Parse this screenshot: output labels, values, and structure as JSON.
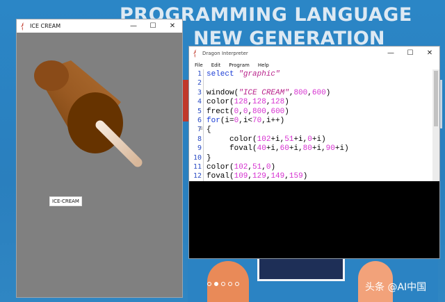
{
  "background": {
    "title_line1": "PROGRAMMING LANGUAGE",
    "title_line2": "NEW GENERATION",
    "watermark": "头条 @AI中国"
  },
  "ice_window": {
    "title": "ICE CREAM",
    "minimize": "—",
    "maximize": "☐",
    "close": "✕",
    "label": "ICE-CREAM",
    "canvas_color": "#808080"
  },
  "interpreter_window": {
    "title": "Dragon Interpreter",
    "minimize": "—",
    "maximize": "☐",
    "close": "✕",
    "menu": [
      "File",
      "Edit",
      "Program",
      "Help"
    ],
    "line_numbers": [
      "1",
      "2",
      "3",
      "4",
      "5",
      "6",
      "7",
      "8",
      "9",
      "10",
      "11",
      "12"
    ],
    "code": [
      [
        {
          "t": "kw",
          "v": "select "
        },
        {
          "t": "str",
          "v": "\"graphic\""
        }
      ],
      [],
      [
        {
          "t": "p",
          "v": "window("
        },
        {
          "t": "str",
          "v": "\"ICE CREAM\""
        },
        {
          "t": "p",
          "v": ","
        },
        {
          "t": "num",
          "v": "800"
        },
        {
          "t": "p",
          "v": ","
        },
        {
          "t": "num",
          "v": "600"
        },
        {
          "t": "p",
          "v": ")"
        }
      ],
      [
        {
          "t": "p",
          "v": "color("
        },
        {
          "t": "num",
          "v": "128"
        },
        {
          "t": "p",
          "v": ","
        },
        {
          "t": "num",
          "v": "128"
        },
        {
          "t": "p",
          "v": ","
        },
        {
          "t": "num",
          "v": "128"
        },
        {
          "t": "p",
          "v": ")"
        }
      ],
      [
        {
          "t": "p",
          "v": "frect("
        },
        {
          "t": "num",
          "v": "0"
        },
        {
          "t": "p",
          "v": ","
        },
        {
          "t": "num",
          "v": "0"
        },
        {
          "t": "p",
          "v": ","
        },
        {
          "t": "num",
          "v": "800"
        },
        {
          "t": "p",
          "v": ","
        },
        {
          "t": "num",
          "v": "600"
        },
        {
          "t": "p",
          "v": ")"
        }
      ],
      [
        {
          "t": "kw",
          "v": "for"
        },
        {
          "t": "p",
          "v": "(i="
        },
        {
          "t": "num",
          "v": "0"
        },
        {
          "t": "p",
          "v": ",i<"
        },
        {
          "t": "num",
          "v": "70"
        },
        {
          "t": "p",
          "v": ",i++)"
        }
      ],
      [
        {
          "t": "p",
          "v": "{"
        }
      ],
      [
        {
          "t": "p",
          "v": "     color("
        },
        {
          "t": "num",
          "v": "102"
        },
        {
          "t": "p",
          "v": "+i,"
        },
        {
          "t": "num",
          "v": "51"
        },
        {
          "t": "p",
          "v": "+i,"
        },
        {
          "t": "num",
          "v": "0"
        },
        {
          "t": "p",
          "v": "+i)"
        }
      ],
      [
        {
          "t": "p",
          "v": "     foval("
        },
        {
          "t": "num",
          "v": "40"
        },
        {
          "t": "p",
          "v": "+i,"
        },
        {
          "t": "num",
          "v": "60"
        },
        {
          "t": "p",
          "v": "+i,"
        },
        {
          "t": "num",
          "v": "80"
        },
        {
          "t": "p",
          "v": "+i,"
        },
        {
          "t": "num",
          "v": "90"
        },
        {
          "t": "p",
          "v": "+i)"
        }
      ],
      [
        {
          "t": "p",
          "v": "}"
        }
      ],
      [
        {
          "t": "p",
          "v": "color("
        },
        {
          "t": "num",
          "v": "102"
        },
        {
          "t": "p",
          "v": ","
        },
        {
          "t": "num",
          "v": "51"
        },
        {
          "t": "p",
          "v": ","
        },
        {
          "t": "num",
          "v": "0"
        },
        {
          "t": "p",
          "v": ")"
        }
      ],
      [
        {
          "t": "p",
          "v": "foval("
        },
        {
          "t": "num",
          "v": "109"
        },
        {
          "t": "p",
          "v": ","
        },
        {
          "t": "num",
          "v": "129"
        },
        {
          "t": "p",
          "v": ","
        },
        {
          "t": "num",
          "v": "149"
        },
        {
          "t": "p",
          "v": ","
        },
        {
          "t": "num",
          "v": "159"
        },
        {
          "t": "p",
          "v": ")"
        }
      ]
    ]
  },
  "colors": {
    "keyword": "#1a3cd6",
    "string": "#b8208a",
    "number": "#d62fd0",
    "console_bg": "#000000"
  }
}
